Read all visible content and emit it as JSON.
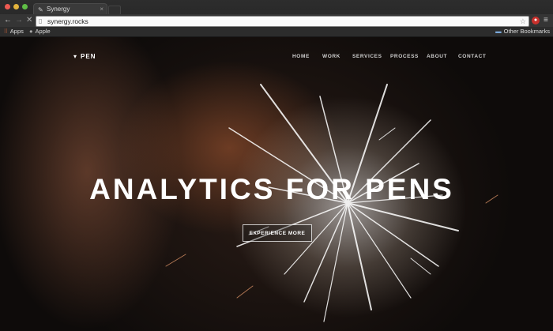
{
  "browser": {
    "tab_title": "Synergy",
    "tab_close": "×",
    "url": "synergy.rocks",
    "bookmarks": {
      "apps": "Apps",
      "apple": "Apple",
      "other": "Other Bookmarks"
    }
  },
  "site": {
    "logo": "PEN",
    "nav": [
      "HOME",
      "WORK",
      "SERVICES",
      "PROCESS",
      "ABOUT",
      "CONTACT"
    ],
    "headline": "ANALYTICS FOR PENS",
    "cta": "EXPERIENCE MORE"
  },
  "colors": {
    "chrome_bg": "#2d2d2d",
    "traffic_red": "#ee5a52",
    "traffic_yellow": "#e3b43c",
    "traffic_green": "#5fbd46",
    "extension_red": "#c9302c"
  },
  "icons": [
    "back-arrow-icon",
    "forward-arrow-icon",
    "stop-icon",
    "page-icon",
    "star-icon",
    "menu-icon",
    "apps-grid-icon",
    "apple-icon",
    "folder-icon",
    "pen-logo-icon"
  ]
}
